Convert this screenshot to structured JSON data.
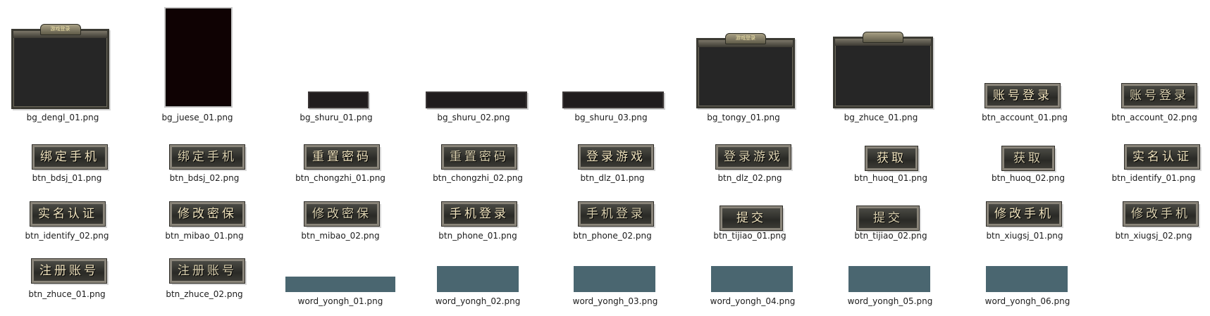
{
  "files": [
    {
      "name": "bg_dengl_01.png",
      "kind": "panel",
      "crest_text": "游戏登录"
    },
    {
      "name": "bg_juese_01.png",
      "kind": "tall"
    },
    {
      "name": "bg_shuru_01.png",
      "kind": "input"
    },
    {
      "name": "bg_shuru_02.png",
      "kind": "input"
    },
    {
      "name": "bg_shuru_03.png",
      "kind": "input"
    },
    {
      "name": "bg_tongy_01.png",
      "kind": "panel",
      "crest_text": "游戏登录"
    },
    {
      "name": "bg_zhuce_01.png",
      "kind": "panel",
      "crest_text": ""
    },
    {
      "name": "btn_account_01.png",
      "kind": "button",
      "text": "账号登录"
    },
    {
      "name": "btn_account_02.png",
      "kind": "button",
      "text": "账号登录"
    },
    {
      "name": "btn_bdsj_01.png",
      "kind": "button",
      "text": "绑定手机"
    },
    {
      "name": "btn_bdsj_02.png",
      "kind": "button",
      "text": "绑定手机"
    },
    {
      "name": "btn_chongzhi_01.png",
      "kind": "button",
      "text": "重置密码"
    },
    {
      "name": "btn_chongzhi_02.png",
      "kind": "button",
      "text": "重置密码"
    },
    {
      "name": "btn_dlz_01.png",
      "kind": "button",
      "text": "登录游戏"
    },
    {
      "name": "btn_dlz_02.png",
      "kind": "button",
      "text": "登录游戏"
    },
    {
      "name": "btn_huoq_01.png",
      "kind": "button",
      "text": "获取"
    },
    {
      "name": "btn_huoq_02.png",
      "kind": "button",
      "text": "获取"
    },
    {
      "name": "btn_identify_01.png",
      "kind": "button",
      "text": "实名认证"
    },
    {
      "name": "btn_identify_02.png",
      "kind": "button",
      "text": "实名认证"
    },
    {
      "name": "btn_mibao_01.png",
      "kind": "button",
      "text": "修改密保"
    },
    {
      "name": "btn_mibao_02.png",
      "kind": "button",
      "text": "修改密保"
    },
    {
      "name": "btn_phone_01.png",
      "kind": "button",
      "text": "手机登录"
    },
    {
      "name": "btn_phone_02.png",
      "kind": "button",
      "text": "手机登录"
    },
    {
      "name": "btn_tijiao_01.png",
      "kind": "button",
      "text": "提交"
    },
    {
      "name": "btn_tijiao_02.png",
      "kind": "button",
      "text": "提交"
    },
    {
      "name": "btn_xiugsj_01.png",
      "kind": "button",
      "text": "修改手机"
    },
    {
      "name": "btn_xiugsj_02.png",
      "kind": "button",
      "text": "修改手机"
    },
    {
      "name": "btn_zhuce_01.png",
      "kind": "button",
      "text": "注册账号"
    },
    {
      "name": "btn_zhuce_02.png",
      "kind": "button",
      "text": "注册账号"
    },
    {
      "name": "word_yongh_01.png",
      "kind": "word"
    },
    {
      "name": "word_yongh_02.png",
      "kind": "word"
    },
    {
      "name": "word_yongh_03.png",
      "kind": "word"
    },
    {
      "name": "word_yongh_04.png",
      "kind": "word"
    },
    {
      "name": "word_yongh_05.png",
      "kind": "word"
    },
    {
      "name": "word_yongh_06.png",
      "kind": "word"
    }
  ]
}
